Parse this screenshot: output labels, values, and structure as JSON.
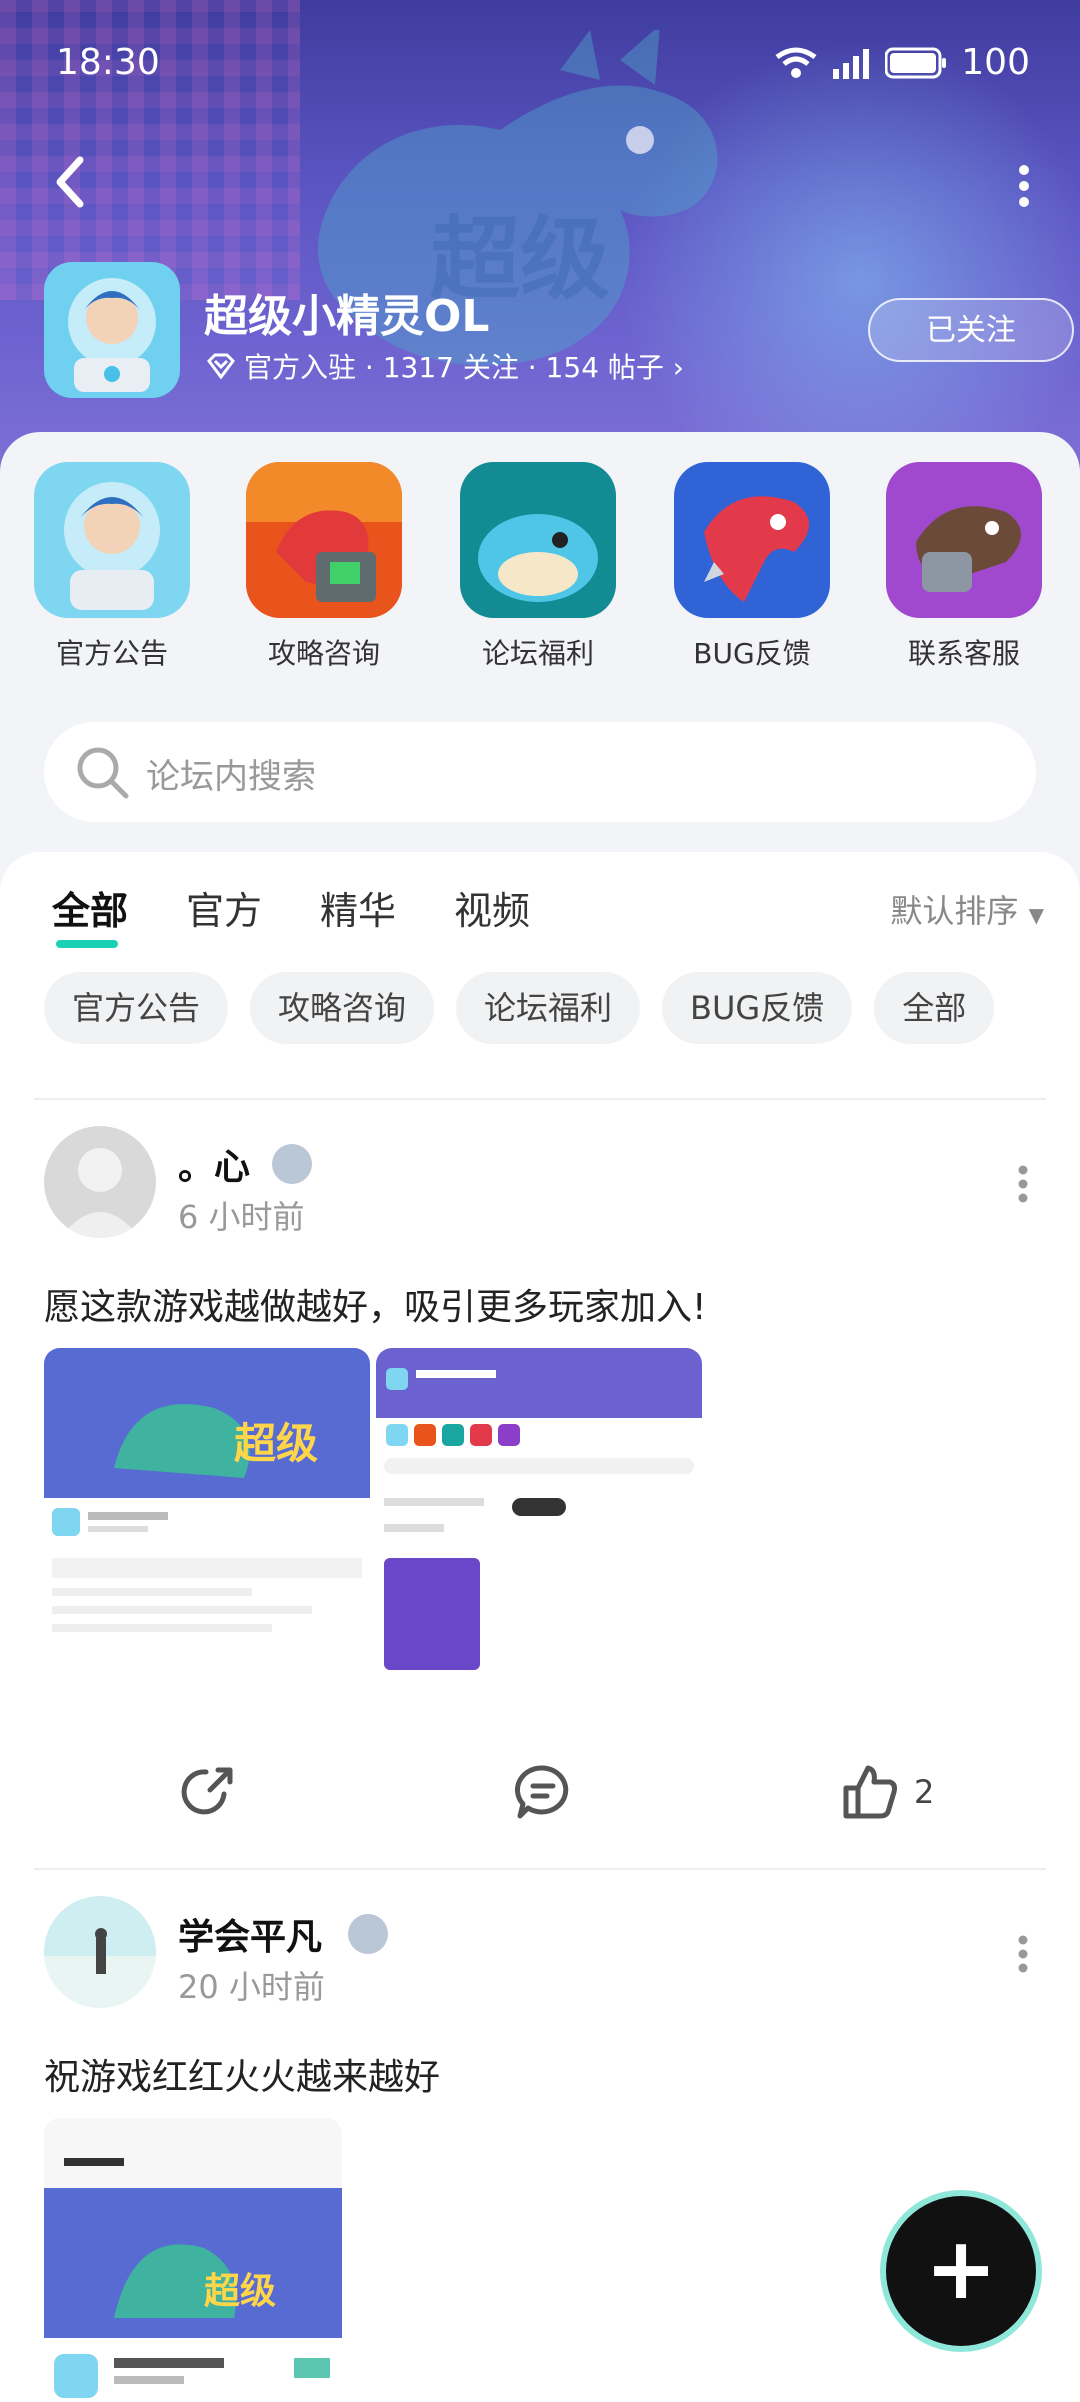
{
  "status_bar": {
    "time": "18:30",
    "battery": "100"
  },
  "forum": {
    "title": "超级小精灵OL",
    "meta": "官方入驻 · 1317 关注 · 154 帖子 ›",
    "follow_label": "已关注"
  },
  "categories": [
    {
      "label": "官方公告",
      "icon": "official-announcement-icon"
    },
    {
      "label": "攻略咨询",
      "icon": "guide-icon"
    },
    {
      "label": "论坛福利",
      "icon": "welfare-icon"
    },
    {
      "label": "BUG反馈",
      "icon": "bug-feedback-icon"
    },
    {
      "label": "联系客服",
      "icon": "customer-service-icon"
    }
  ],
  "search": {
    "placeholder": "论坛内搜索"
  },
  "tabs": [
    "全部",
    "官方",
    "精华",
    "视频"
  ],
  "sort_label": "默认排序",
  "chips": [
    "官方公告",
    "攻略咨询",
    "论坛福利",
    "BUG反馈",
    "全部"
  ],
  "posts": [
    {
      "username": "。心",
      "time": "6 小时前",
      "text": "愿这款游戏越做越好，吸引更多玩家加入!",
      "likes": "2"
    },
    {
      "username": "学会平凡",
      "time": "20 小时前",
      "text": "祝游戏红红火火越来越好"
    }
  ],
  "colors": {
    "accent": "#1ed0b3",
    "header": "#5b55c2"
  }
}
